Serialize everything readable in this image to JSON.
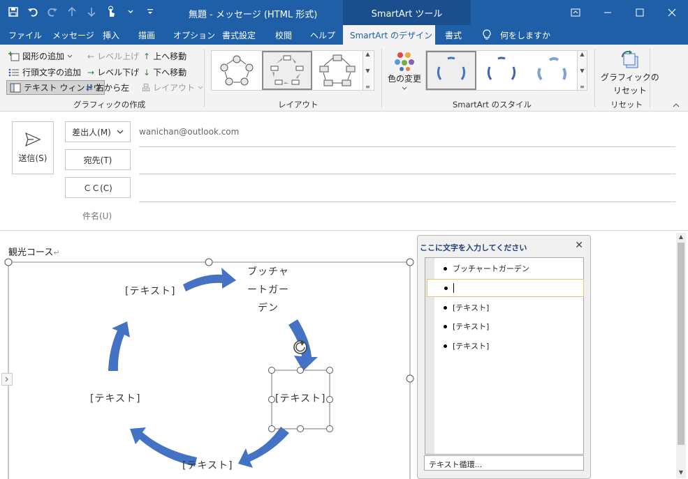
{
  "quick_access": {
    "save": "save-icon",
    "undo": "undo-icon",
    "redo": "redo-icon",
    "up": "up-arrow-icon",
    "down": "down-arrow-icon",
    "touch": "touch-mode-icon",
    "customize": "customize-icon"
  },
  "window": {
    "title": "無題  -  メッセージ (HTML 形式)",
    "context_tab": "SmartArt ツール"
  },
  "tabs": [
    {
      "label": "ファイル"
    },
    {
      "label": "メッセージ"
    },
    {
      "label": "挿入"
    },
    {
      "label": "描画"
    },
    {
      "label": "オプション"
    },
    {
      "label": "書式設定"
    },
    {
      "label": "校閲"
    },
    {
      "label": "ヘルプ"
    },
    {
      "label": "SmartArt のデザイン"
    },
    {
      "label": "書式"
    },
    {
      "label": "何をしますか"
    }
  ],
  "ribbon": {
    "create": {
      "add_shape": "図形の追加",
      "add_bullet": "行頭文字の追加",
      "text_pane": "テキスト ウィンドウ",
      "promote": "レベル上げ",
      "demote": "レベル下げ",
      "rtl": "右から左",
      "move_up": "上へ移動",
      "move_down": "下へ移動",
      "layout": "レイアウト",
      "group": "グラフィックの作成"
    },
    "layouts_group": "レイアウト",
    "colors": "色の変更",
    "styles_group": "SmartArt のスタイル",
    "reset_button_line1": "グラフィックの",
    "reset_button_line2": "リセット",
    "reset_group": "リセット"
  },
  "compose": {
    "send": "送信(S)",
    "from": "差出人(M)",
    "from_value": "wanichan@outlook.com",
    "to": "宛先(T)",
    "cc": "ＣＣ(C)",
    "subject": "件名(U)"
  },
  "body": {
    "text": "観光コース",
    "smartart": {
      "title_lines": [
        "ブッチャ",
        "ートガー",
        "デン"
      ],
      "labels": [
        "[テキスト]",
        "[テキスト]",
        "[テキスト]",
        "[テキスト]"
      ]
    }
  },
  "text_pane": {
    "title": "ここに文字を入力してください",
    "items": [
      "ブッチャートガーデン",
      "",
      "[テキスト]",
      "[テキスト]",
      "[テキスト]"
    ],
    "footer": "テキスト循環..."
  },
  "colors": {
    "titlebar": "#1f5fa8",
    "accent": "#4472c4"
  }
}
